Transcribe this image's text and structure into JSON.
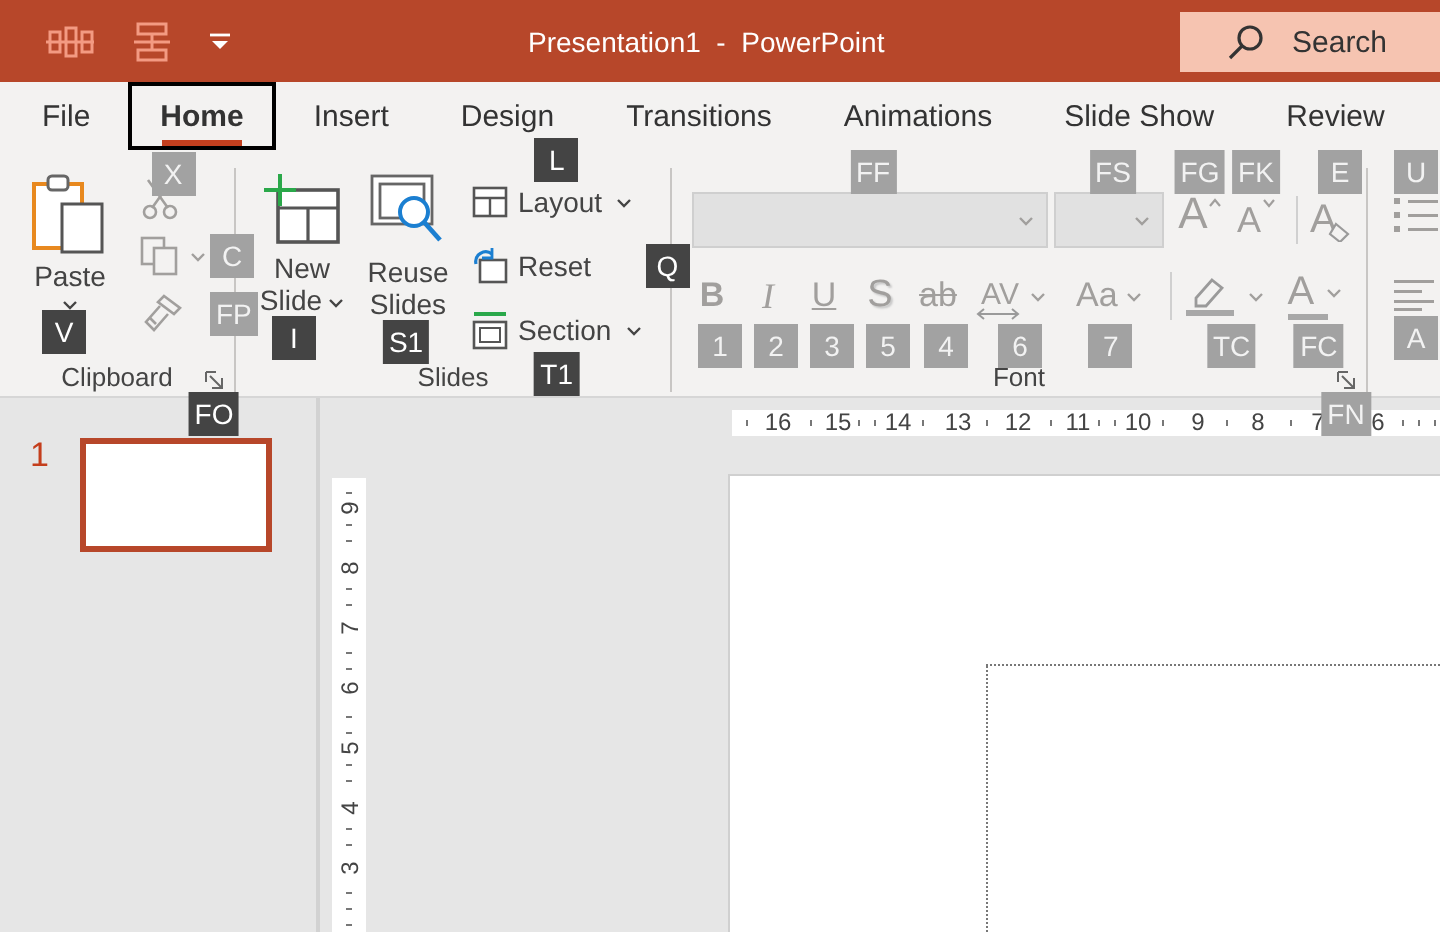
{
  "title_bar": {
    "title": "Presentation1  -  PowerPoint",
    "search": {
      "placeholder": "Search"
    }
  },
  "tabs": [
    {
      "label": "File",
      "selected": false
    },
    {
      "label": "Home",
      "selected": true
    },
    {
      "label": "Insert",
      "selected": false
    },
    {
      "label": "Design",
      "selected": false
    },
    {
      "label": "Transitions",
      "selected": false
    },
    {
      "label": "Animations",
      "selected": false
    },
    {
      "label": "Slide Show",
      "selected": false
    },
    {
      "label": "Review",
      "selected": false
    }
  ],
  "ribbon": {
    "groups": [
      {
        "kind": "clipboard",
        "label": "Clipboard",
        "launcher_keytip": "FO",
        "controls": [
          {
            "kind": "paste",
            "label": "Paste",
            "keytip": "V",
            "disabled": false
          },
          {
            "kind": "cut",
            "keytip": "X",
            "disabled": true
          },
          {
            "kind": "copy",
            "keytip": "C",
            "disabled": true
          },
          {
            "kind": "format_painter",
            "keytip": "FP",
            "disabled": true
          }
        ]
      },
      {
        "kind": "slides",
        "label": "Slides",
        "controls": [
          {
            "kind": "new_slide",
            "label": "New Slide",
            "keytip": "I",
            "disabled": false
          },
          {
            "kind": "reuse_slides",
            "label": "Reuse Slides",
            "keytip": "S1",
            "disabled": false
          },
          {
            "kind": "layout",
            "label": "Layout",
            "keytip": "L",
            "disabled": false
          },
          {
            "kind": "reset",
            "label": "Reset",
            "keytip": "Q",
            "disabled": false
          },
          {
            "kind": "section",
            "label": "Section",
            "keytip": "T1",
            "disabled": false
          }
        ]
      },
      {
        "kind": "font",
        "label": "Font",
        "launcher_keytip": "FN",
        "controls": [
          {
            "kind": "font_name",
            "keytip": "FF",
            "disabled": true
          },
          {
            "kind": "font_size",
            "keytip": "FS",
            "disabled": true
          },
          {
            "kind": "grow",
            "glyph": "A",
            "keytip": "FG",
            "disabled": true
          },
          {
            "kind": "shrink",
            "glyph": "A",
            "keytip": "FK",
            "disabled": true
          },
          {
            "kind": "clear",
            "glyph": "A",
            "keytip": "E",
            "disabled": true
          },
          {
            "kind": "bold",
            "glyph": "B",
            "keytip": "1",
            "disabled": true
          },
          {
            "kind": "italic",
            "glyph": "I",
            "keytip": "2",
            "disabled": true
          },
          {
            "kind": "underline",
            "glyph": "U",
            "keytip": "3",
            "disabled": true
          },
          {
            "kind": "shadow",
            "glyph": "S",
            "keytip": "5",
            "disabled": true
          },
          {
            "kind": "strike",
            "glyph": "ab",
            "keytip": "4",
            "disabled": true
          },
          {
            "kind": "spacing",
            "glyph": "AV",
            "keytip": "6",
            "disabled": true
          },
          {
            "kind": "case",
            "glyph": "Aa",
            "keytip": "7",
            "disabled": true
          },
          {
            "kind": "highlight",
            "keytip": "TC",
            "disabled": true
          },
          {
            "kind": "font_color",
            "glyph": "A",
            "keytip": "FC",
            "disabled": true
          }
        ]
      },
      {
        "kind": "paragraph",
        "controls": [
          {
            "kind": "bullets",
            "keytip": "U",
            "disabled": true
          },
          {
            "kind": "align",
            "keytip": "A",
            "disabled": true
          }
        ]
      }
    ]
  },
  "slides": [
    {
      "number": "1",
      "selected": true
    }
  ],
  "horizontal_ruler": [
    "16",
    "15",
    "14",
    "13",
    "12",
    "11",
    "10",
    "9",
    "8",
    "7",
    "6"
  ],
  "vertical_ruler": [
    "9",
    "8",
    "7",
    "6",
    "5",
    "4",
    "3"
  ]
}
